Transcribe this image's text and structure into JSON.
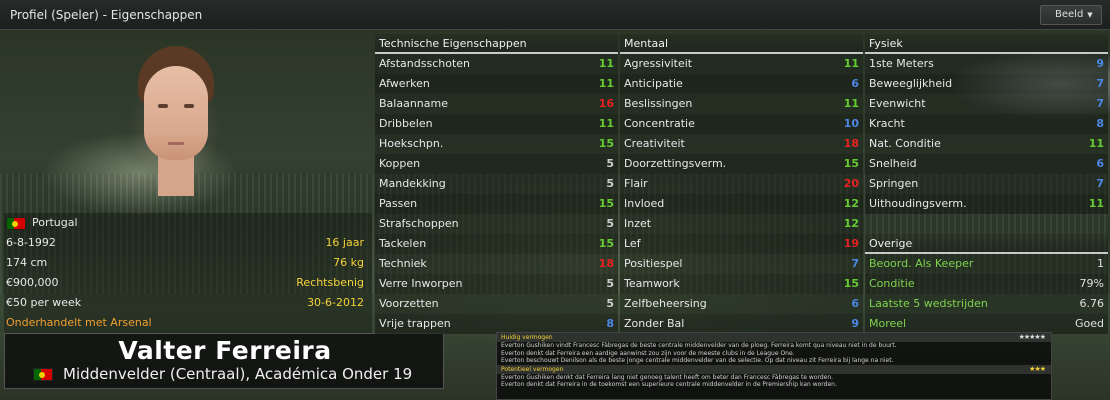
{
  "header": {
    "title": "Profiel (Speler) - Eigenschappen",
    "view_button": "Beeld"
  },
  "player": {
    "name": "Valter Ferreira",
    "position_club": "Middenvelder (Centraal), Académica Onder 19",
    "nationality": "Portugal",
    "birthdate": "6-8-1992",
    "age": "16 jaar",
    "height": "174 cm",
    "weight": "76 kg",
    "value": "€900,000",
    "foot": "Rechtsbenig",
    "wage": "€50 per week",
    "contract_end": "30-6-2012",
    "transfer_status": "Onderhandelt met Arsenal"
  },
  "technical": {
    "header": "Technische Eigenschappen",
    "items": [
      {
        "label": "Afstandsschoten",
        "value": "11",
        "color": "#66cc33"
      },
      {
        "label": "Afwerken",
        "value": "11",
        "color": "#66cc33"
      },
      {
        "label": "Balaanname",
        "value": "16",
        "color": "#e82222"
      },
      {
        "label": "Dribbelen",
        "value": "11",
        "color": "#66cc33"
      },
      {
        "label": "Hoekschpn.",
        "value": "15",
        "color": "#66cc33"
      },
      {
        "label": "Koppen",
        "value": "5",
        "color": "#cfcfcf"
      },
      {
        "label": "Mandekking",
        "value": "5",
        "color": "#cfcfcf"
      },
      {
        "label": "Passen",
        "value": "15",
        "color": "#66cc33"
      },
      {
        "label": "Strafschoppen",
        "value": "5",
        "color": "#cfcfcf"
      },
      {
        "label": "Tackelen",
        "value": "15",
        "color": "#66cc33"
      },
      {
        "label": "Techniek",
        "value": "18",
        "color": "#e82222"
      },
      {
        "label": "Verre Inworpen",
        "value": "5",
        "color": "#cfcfcf"
      },
      {
        "label": "Voorzetten",
        "value": "5",
        "color": "#cfcfcf"
      },
      {
        "label": "Vrije trappen",
        "value": "8",
        "color": "#4d87e6"
      }
    ]
  },
  "mental": {
    "header": "Mentaal",
    "items": [
      {
        "label": "Agressiviteit",
        "value": "11",
        "color": "#66cc33"
      },
      {
        "label": "Anticipatie",
        "value": "6",
        "color": "#4d87e6"
      },
      {
        "label": "Beslissingen",
        "value": "11",
        "color": "#66cc33"
      },
      {
        "label": "Concentratie",
        "value": "10",
        "color": "#4d87e6"
      },
      {
        "label": "Creativiteit",
        "value": "18",
        "color": "#e82222"
      },
      {
        "label": "Doorzettingsverm.",
        "value": "15",
        "color": "#66cc33"
      },
      {
        "label": "Flair",
        "value": "20",
        "color": "#e82222"
      },
      {
        "label": "Invloed",
        "value": "12",
        "color": "#66cc33"
      },
      {
        "label": "Inzet",
        "value": "12",
        "color": "#66cc33"
      },
      {
        "label": "Lef",
        "value": "19",
        "color": "#e82222"
      },
      {
        "label": "Positiespel",
        "value": "7",
        "color": "#4d87e6"
      },
      {
        "label": "Teamwork",
        "value": "15",
        "color": "#66cc33"
      },
      {
        "label": "Zelfbeheersing",
        "value": "6",
        "color": "#4d87e6"
      },
      {
        "label": "Zonder Bal",
        "value": "9",
        "color": "#4d87e6"
      }
    ]
  },
  "physical": {
    "header": "Fysiek",
    "items": [
      {
        "label": "1ste Meters",
        "value": "9",
        "color": "#4d87e6"
      },
      {
        "label": "Beweeglijkheid",
        "value": "7",
        "color": "#4d87e6"
      },
      {
        "label": "Evenwicht",
        "value": "7",
        "color": "#4d87e6"
      },
      {
        "label": "Kracht",
        "value": "8",
        "color": "#4d87e6"
      },
      {
        "label": "Nat. Conditie",
        "value": "11",
        "color": "#66cc33"
      },
      {
        "label": "Snelheid",
        "value": "6",
        "color": "#4d87e6"
      },
      {
        "label": "Springen",
        "value": "7",
        "color": "#4d87e6"
      },
      {
        "label": "Uithoudingsverm.",
        "value": "11",
        "color": "#66cc33"
      }
    ]
  },
  "other": {
    "header": "Overige",
    "items": [
      {
        "label": "Beoord. Als Keeper",
        "value": "1"
      },
      {
        "label": "Conditie",
        "value": "79%"
      },
      {
        "label": "Laatste 5 wedstrijden",
        "value": "6.76"
      },
      {
        "label": "Moreel",
        "value": "Goed"
      }
    ]
  },
  "reports": {
    "current_header": "Huidig vermogen",
    "current_lines": [
      "Everton Gushiken vindt Francesc Fàbregas de beste centrale middenvelder van de ploeg. Ferreira komt qua niveau niet in de buurt.",
      "Everton denkt dat Ferreira een aardige aanwinst zou zijn voor de meeste clubs in de League One.",
      "Everton beschouwt Denilson als de beste jonge centrale middenvelder van de selectie. Op dat niveau zit Ferreira bij lange na niet."
    ],
    "potential_header": "Potentieel vermogen",
    "potential_lines": [
      "Everton Gushiken denkt dat Ferreira lang niet genoeg talent heeft om beter dan Francesc Fàbregas te worden.",
      "Everton denkt dat Ferreira in de toekomst een superieure centrale middenvelder in de Premiership kan worden."
    ]
  }
}
